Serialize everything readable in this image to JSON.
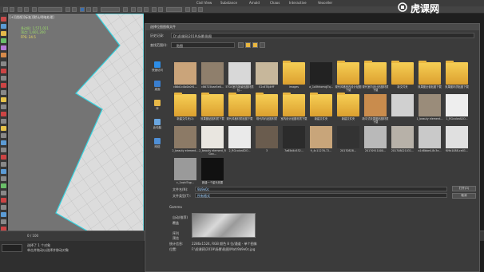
{
  "app": {
    "menus": [
      "Civil View",
      "Substance",
      "Arnold",
      "Chaos",
      "Interactive",
      "Vexceller"
    ],
    "viewport_label": "[+][透视][标准][默认明暗处理]",
    "stats": [
      "多边形: 1,571,021",
      "顶点: 1,601,200",
      "FPS: 24.5"
    ],
    "status_lines": [
      "选择了 1 个对象",
      "单击并拖动以选择并移动对象"
    ],
    "timeline_text": "0 / 100"
  },
  "dialog": {
    "title": "选择位图图像文件",
    "history_label": "历史记录:",
    "history_path": "D:\\虎课网\\2019\\场景\\贴图",
    "lookin_label": "查找范围(I):",
    "lookin_value": "贴图",
    "places": [
      {
        "label": "快速访问",
        "color": "#2d8de6"
      },
      {
        "label": "桌面",
        "color": "#3a7fd0"
      },
      {
        "label": "库",
        "color": "#e7b848"
      },
      {
        "label": "此电脑",
        "color": "#6aa6e0"
      },
      {
        "label": "网络",
        "color": "#4f8fd6"
      }
    ],
    "files": [
      {
        "name": "c86d1c0b0b091...",
        "kind": "photo",
        "color": "#caa47a"
      },
      {
        "name": "c86725bae5e6...",
        "kind": "photo",
        "color": "#8f7f6c"
      },
      {
        "name": "5TGS室内场景贴图材质包...",
        "kind": "photo",
        "color": "#d8d8d8"
      },
      {
        "name": "E2c8T8j4ffF",
        "kind": "photo",
        "color": "#c7b79b"
      },
      {
        "name": "images",
        "kind": "folder"
      },
      {
        "name": "a_1o5hhomqj7q...",
        "kind": "photo",
        "color": "#222"
      },
      {
        "name": "现代风格室内设计贴图下载",
        "kind": "folder"
      },
      {
        "name": "现代室内设计贴图材质下载",
        "kind": "folder"
      },
      {
        "name": "新文件夹",
        "kind": "folder"
      },
      {
        "name": "效果图全套贴图下载",
        "kind": "folder"
      },
      {
        "name": "效果图材质贴图下载",
        "kind": "folder"
      },
      {
        "name": "新建文件夹(2)",
        "kind": "folder"
      },
      {
        "name": "效果图贴图材质下载",
        "kind": "folder"
      },
      {
        "name": "现代风格材质贴图下载",
        "kind": "folder"
      },
      {
        "name": "现代简约贴图材质",
        "kind": "folder"
      },
      {
        "name": "室内设计贴图材质下载",
        "kind": "folder"
      },
      {
        "name": "新建文件夹",
        "kind": "folder"
      },
      {
        "name": "新建文件夹",
        "kind": "folder"
      },
      {
        "name": "新中式效果图贴图材质下载",
        "kind": "photo",
        "color": "#c98c4d"
      },
      {
        "name": "",
        "kind": "photo",
        "color": "#d0d0d0"
      },
      {
        "name": "1_beauty element...",
        "kind": "photo",
        "color": "#9a8c7a"
      },
      {
        "name": "1_RGcolorADO...",
        "kind": "photo",
        "color": "#eeeeee"
      },
      {
        "name": "2_beauty element...",
        "kind": "photo",
        "color": "#8c7a66"
      },
      {
        "name": "2_beauty element_RGco...",
        "kind": "photo",
        "color": "#e9e6e0"
      },
      {
        "name": "2_RGcolorADO...",
        "kind": "photo",
        "color": "#eaeaea"
      },
      {
        "name": "3",
        "kind": "photo",
        "color": "#6a5c4e"
      },
      {
        "name": "7a65d4c532...",
        "kind": "photo",
        "color": "#2b2b2b"
      },
      {
        "name": "9_4c11276-72...",
        "kind": "photo",
        "color": "#c8a57a"
      },
      {
        "name": "20170828...",
        "kind": "photo",
        "color": "#333333"
      },
      {
        "name": "20170911000...",
        "kind": "photo",
        "color": "#b9b9b9"
      },
      {
        "name": "201708021031...",
        "kind": "photo",
        "color": "#b7b1a8"
      },
      {
        "name": "a1d8bbe4-8c3e...",
        "kind": "photo",
        "color": "#c9c9c9"
      },
      {
        "name": "f09b1088-ce01...",
        "kind": "photo",
        "color": "#e0e0e0"
      },
      {
        "name": "c_1cqhl7qp...",
        "kind": "photo",
        "color": "#9a9a9a"
      },
      {
        "name": "新建一个星光效果",
        "kind": "photo",
        "color": "#111111"
      }
    ],
    "filename_label": "文件名(N):",
    "filename_value": "9b9e0c",
    "filetype_label": "文件类型(T):",
    "filetype_value": "所有格式",
    "open_button": "打开(O)",
    "cancel_button": "取消",
    "gamma_title": "Gamma",
    "gamma_auto": "自动(推荐)",
    "gamma_override": "覆盖",
    "sequence_label": "序列",
    "preview_label": "预览",
    "stats_label": "统计信息:",
    "stats_value": "2286x1524, RGB 颜色 8 位/通道 - 单个图像",
    "location_label": "位置:",
    "location_value": "F:\\虎课网\\2019\\场景\\贴图\\Mat\\9b9e0c.jpg"
  },
  "watermark": "虎课网"
}
